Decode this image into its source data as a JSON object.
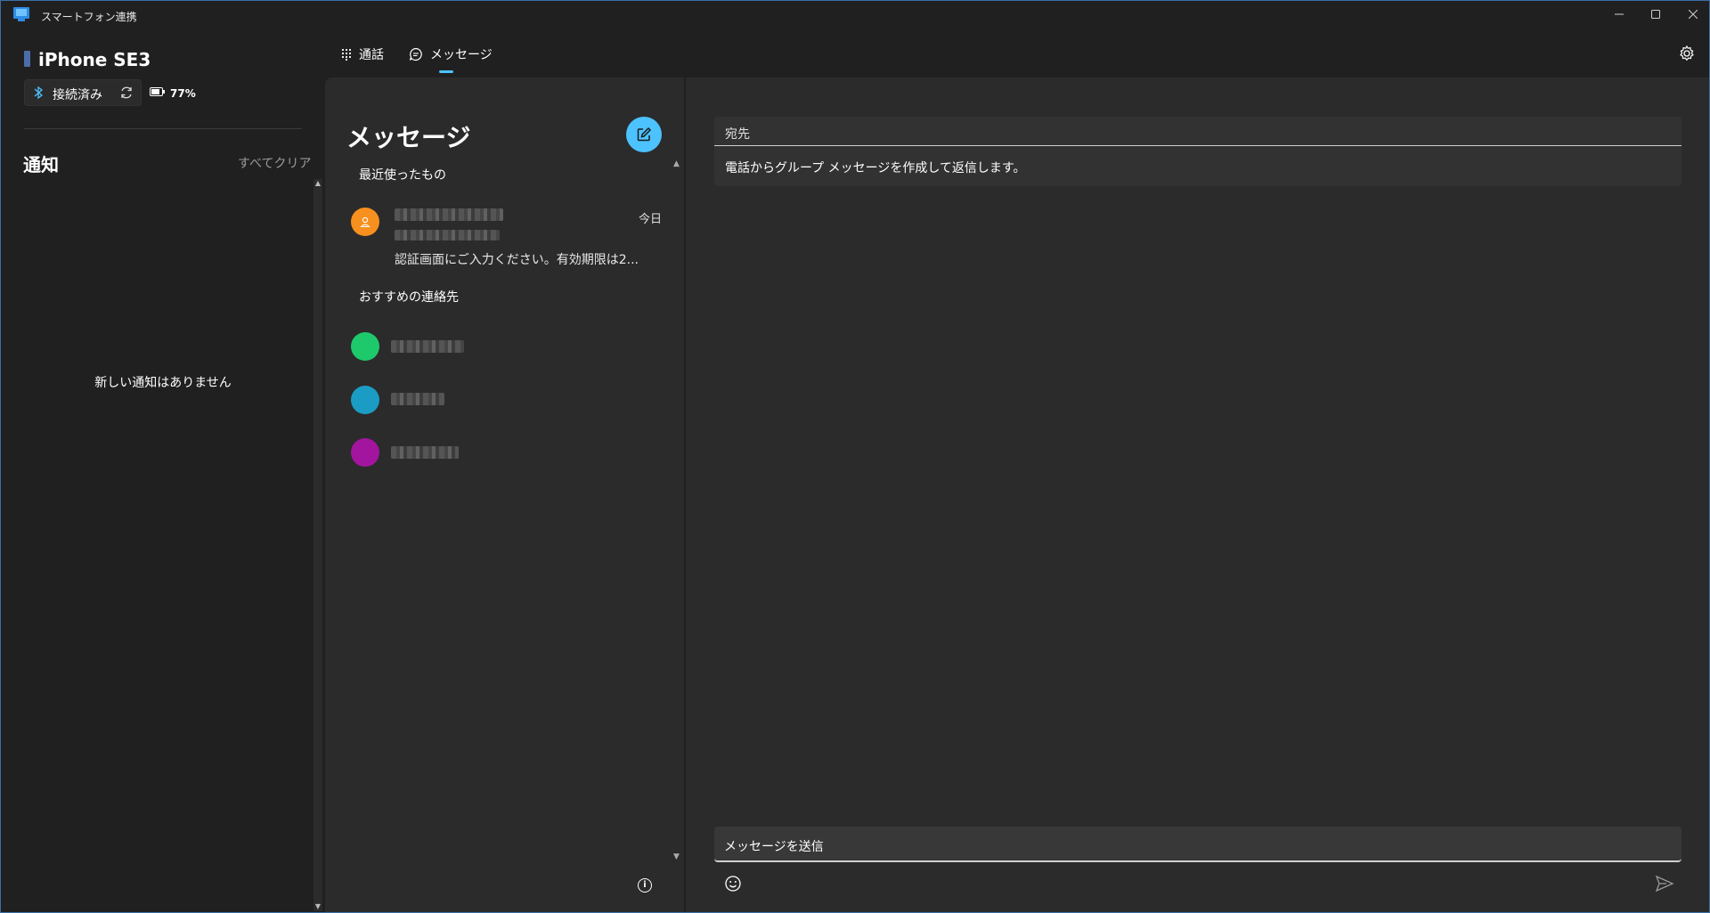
{
  "window": {
    "title": "スマートフォン連携",
    "controls": [
      "minimize",
      "maximize",
      "close"
    ]
  },
  "device": {
    "name": "iPhone SE3",
    "connection_status": "接続済み",
    "battery": "77%"
  },
  "notifications": {
    "title": "通知",
    "clear_all": "すべてクリア",
    "empty_message": "新しい通知はありません"
  },
  "tabs": [
    {
      "label": "通話",
      "icon": "dialpad-icon",
      "active": false
    },
    {
      "label": "メッセージ",
      "icon": "chat-bubble-icon",
      "active": true
    }
  ],
  "messages": {
    "title": "メッセージ",
    "recent_section": "最近使ったもの",
    "recent": [
      {
        "time": "今日",
        "preview": "認証画面にご入力ください。有効期限は2...",
        "avatar_color": "#f7901e"
      }
    ],
    "suggested_section": "おすすめの連絡先",
    "suggested": [
      {
        "avatar_color": "#1ec96b"
      },
      {
        "avatar_color": "#1a9cc4"
      },
      {
        "avatar_color": "#a3159e"
      }
    ]
  },
  "conversation": {
    "to_label": "宛先",
    "to_hint": "電話からグループ メッセージを作成して返信します。",
    "send_placeholder": "メッセージを送信"
  },
  "colors": {
    "accent": "#4cc2ff",
    "background": "#202020",
    "panel": "#2b2b2b"
  }
}
